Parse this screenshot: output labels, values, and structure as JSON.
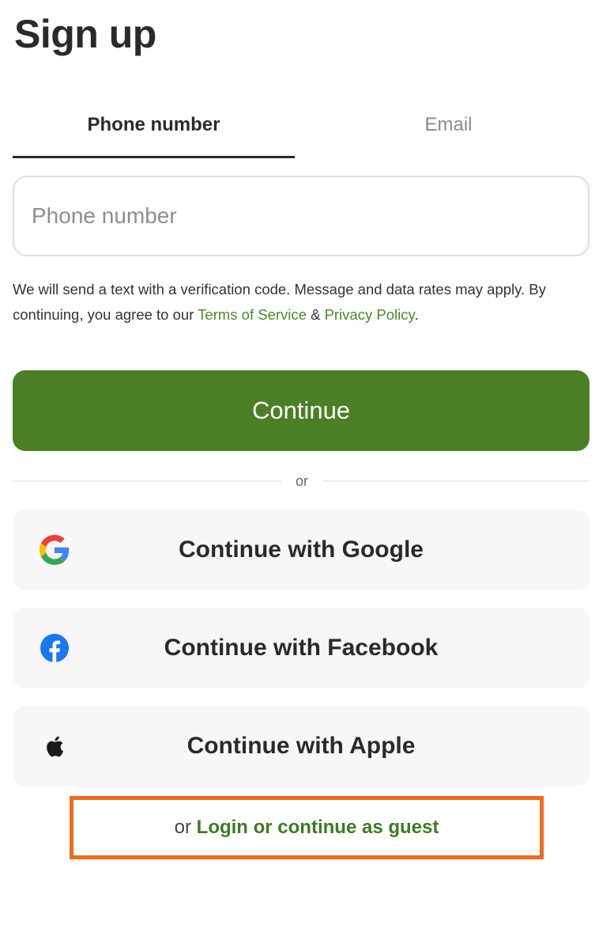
{
  "header": {
    "title": "Sign up"
  },
  "tabs": [
    {
      "label": "Phone number",
      "active": true
    },
    {
      "label": "Email",
      "active": false
    }
  ],
  "phone_input": {
    "placeholder": "Phone number",
    "value": ""
  },
  "disclaimer": {
    "text": "We will send a text with a verification code. Message and data rates may apply. By continuing, you agree to our ",
    "terms_link": "Terms of Service",
    "separator": " & ",
    "privacy_link": "Privacy Policy",
    "end": "."
  },
  "continue_button": {
    "label": "Continue"
  },
  "divider": {
    "label": "or"
  },
  "social_buttons": {
    "google": {
      "label": "Continue with Google",
      "icon": "google-icon"
    },
    "facebook": {
      "label": "Continue with Facebook",
      "icon": "facebook-icon"
    },
    "apple": {
      "label": "Continue with Apple",
      "icon": "apple-icon"
    }
  },
  "guest": {
    "prefix": "or ",
    "link": "Login or continue as guest"
  },
  "colors": {
    "accent": "#4a7f26",
    "link": "#4a8a2a",
    "highlight_box": "#f26a1b",
    "social_bg": "#f7f7f7"
  }
}
